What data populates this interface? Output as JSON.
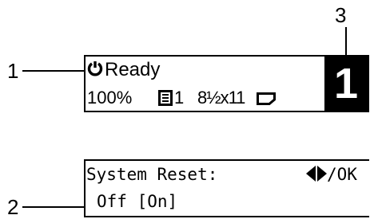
{
  "callouts": {
    "n1": "1",
    "n2": "2",
    "n3": "3"
  },
  "panel_main": {
    "status": "Ready",
    "zoom": "100%",
    "copies": "1",
    "paper_size": "8½x11",
    "counter": "1",
    "icons": [
      "power-icon",
      "tray-icon",
      "paper-orientation-icon"
    ]
  },
  "panel_reset": {
    "title": "System Reset:",
    "nav_hint": "/OK",
    "options_line": "Off [On]",
    "icons": [
      "left-right-arrows-icon"
    ]
  }
}
